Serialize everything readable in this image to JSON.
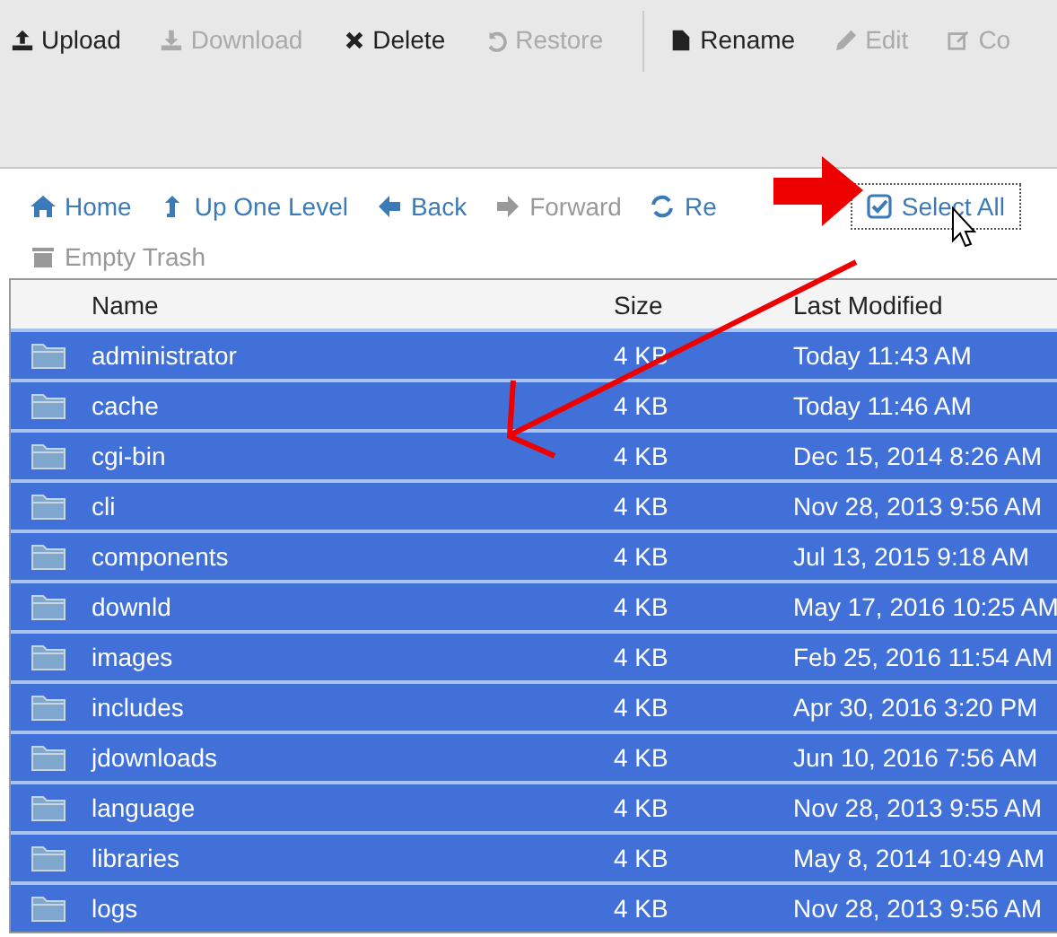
{
  "toolbar": [
    {
      "label": "Upload",
      "disabled": false,
      "group_start": false
    },
    {
      "label": "Download",
      "disabled": true,
      "group_start": false
    },
    {
      "label": "Delete",
      "disabled": false,
      "group_start": false
    },
    {
      "label": "Restore",
      "disabled": true,
      "group_start": false
    },
    {
      "label": "Rename",
      "disabled": false,
      "group_start": true
    },
    {
      "label": "Edit",
      "disabled": true,
      "group_start": false
    },
    {
      "label": "Co",
      "disabled": true,
      "group_start": false
    }
  ],
  "nav": [
    {
      "label": "Home",
      "disabled": false,
      "focused": false
    },
    {
      "label": "Up One Level",
      "disabled": false,
      "focused": false
    },
    {
      "label": "Back",
      "disabled": false,
      "focused": false
    },
    {
      "label": "Forward",
      "disabled": true,
      "focused": false
    },
    {
      "label": "Re",
      "disabled": false,
      "focused": false
    },
    {
      "label": "Select All",
      "disabled": false,
      "focused": true
    },
    {
      "label": "Empty Trash",
      "disabled": true,
      "focused": false
    }
  ],
  "table": {
    "columns": [
      "Name",
      "Size",
      "Last Modified"
    ],
    "rows": [
      {
        "name": "administrator",
        "size": "4 KB",
        "modified": "Today 11:43 AM",
        "selected": true
      },
      {
        "name": "cache",
        "size": "4 KB",
        "modified": "Today 11:46 AM",
        "selected": true
      },
      {
        "name": "cgi-bin",
        "size": "4 KB",
        "modified": "Dec 15, 2014 8:26 AM",
        "selected": true
      },
      {
        "name": "cli",
        "size": "4 KB",
        "modified": "Nov 28, 2013 9:56 AM",
        "selected": true
      },
      {
        "name": "components",
        "size": "4 KB",
        "modified": "Jul 13, 2015 9:18 AM",
        "selected": true
      },
      {
        "name": "downld",
        "size": "4 KB",
        "modified": "May 17, 2016 10:25 AM",
        "selected": true
      },
      {
        "name": "images",
        "size": "4 KB",
        "modified": "Feb 25, 2016 11:54 AM",
        "selected": true
      },
      {
        "name": "includes",
        "size": "4 KB",
        "modified": "Apr 30, 2016 3:20 PM",
        "selected": true
      },
      {
        "name": "jdownloads",
        "size": "4 KB",
        "modified": "Jun 10, 2016 7:56 AM",
        "selected": true
      },
      {
        "name": "language",
        "size": "4 KB",
        "modified": "Nov 28, 2013 9:55 AM",
        "selected": true
      },
      {
        "name": "libraries",
        "size": "4 KB",
        "modified": "May 8, 2014 10:49 AM",
        "selected": true
      },
      {
        "name": "logs",
        "size": "4 KB",
        "modified": "Nov 28, 2013 9:56 AM",
        "selected": true
      }
    ]
  }
}
